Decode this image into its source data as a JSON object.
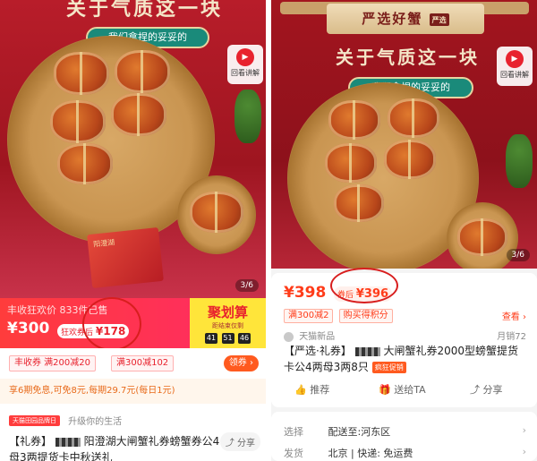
{
  "left": {
    "photo": {
      "headline": "关于气质这一块",
      "subhead": "我们拿捏的妥妥的",
      "review_label": "回看讲解",
      "counter": "3/6"
    },
    "price_strip": {
      "promo_line": "丰收狂欢价  833件已售",
      "price": "¥300",
      "coupon_price_prefix": "狂欢券后",
      "coupon_price": "¥178",
      "brand": "聚划算",
      "brand_sub": "距结束仅剩",
      "countdown": [
        "41",
        "51",
        "46"
      ]
    },
    "coupons": [
      "丰收券 满200减20",
      "满300减102"
    ],
    "get_coupon": "领券 ›",
    "installment": "享6期免息,可免8元,每期29.7元(每日1元)",
    "title": {
      "chip": "天猫田园品牌日",
      "slogan": "升级你的生活",
      "text_prefix": "【礼券】",
      "text_main": "阳澄湖大闸蟹礼券螃蟹券公4母3两提货卡中秋送礼",
      "share": "分享"
    }
  },
  "right": {
    "photo": {
      "banner": "严选好蟹",
      "seal": "严选",
      "headline": "关于气质这一块",
      "subhead": "我们拿捏的妥妥的",
      "review_label": "回看讲解",
      "counter": "3/6"
    },
    "price": {
      "price": "¥398",
      "coupon_prefix": "券后",
      "coupon_price": "¥396",
      "tags": [
        "满300减2",
        "购买得积分"
      ],
      "look": "查看 ›",
      "shop": "天猫新品",
      "sales": "月销72",
      "title_prefix": "【严选·礼券】",
      "title_main": "大闸蟹礼券2000型螃蟹提货卡公4两母3两8只",
      "hot": "疯狂促销"
    },
    "actions": [
      "推荐",
      "送给TA",
      "分享"
    ],
    "info": {
      "select_label": "选择",
      "select_value": "配送至:河东区",
      "ship_label": "发货",
      "ship_value": "北京 | 快递: 免运费"
    }
  }
}
